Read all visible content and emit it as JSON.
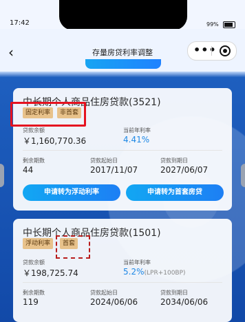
{
  "status_bar": {
    "time": "17:42",
    "battery": "99%"
  },
  "nav": {
    "title": "存量房贷利率调整"
  },
  "loans": [
    {
      "title": "中长期个人商品住房贷款(3521)",
      "tags": [
        "固定利率",
        "非首套"
      ],
      "balance_label": "贷款余额",
      "balance": "￥1,160,770.36",
      "rate_label": "当前年利率",
      "rate": "4.41%",
      "rate_sub": "",
      "term_label": "剩余期数",
      "term": "44",
      "start_label": "贷款起始日",
      "start": "2017/11/07",
      "end_label": "贷款到期日",
      "end": "2027/06/07",
      "button_left": "申请转为浮动利率",
      "button_right": "申请转为首套房贷"
    },
    {
      "title": "中长期个人商品住房贷款(1501)",
      "tags": [
        "浮动利率",
        "首套"
      ],
      "balance_label": "贷款余额",
      "balance": "￥198,725.74",
      "rate_label": "当前年利率",
      "rate": "5.2%",
      "rate_sub": "(LPR+100BP)",
      "term_label": "剩余期数",
      "term": "119",
      "start_label": "贷款起始日",
      "start": "2024/06/06",
      "end_label": "贷款到期日",
      "end": "2034/06/06"
    }
  ],
  "colors": {
    "accent": "#1e88e5",
    "highlight": "#e5121f",
    "tag_bg": "#e8c28b"
  }
}
